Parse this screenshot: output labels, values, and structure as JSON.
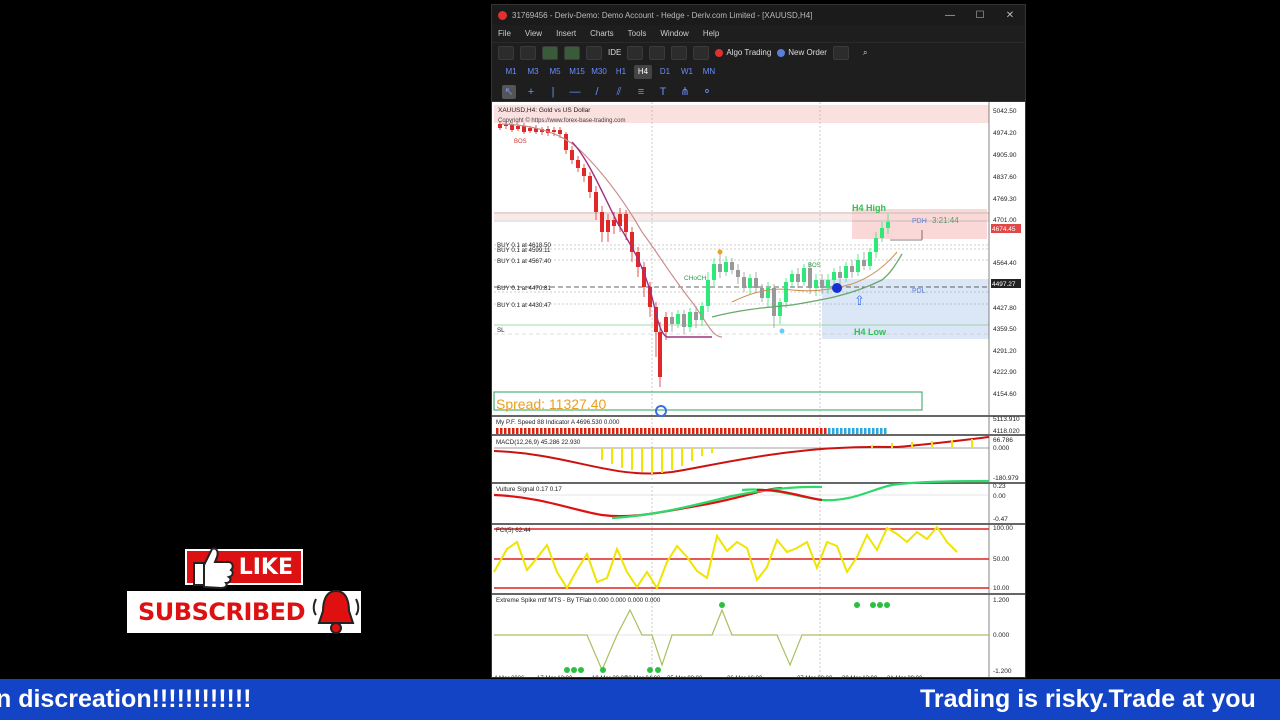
{
  "window": {
    "title": "31769456 - Deriv-Demo: Demo Account - Hedge - Deriv.com Limited - [XAUUSD,H4]",
    "controls": [
      "—",
      "☐",
      "✕"
    ]
  },
  "menu": [
    "File",
    "View",
    "Insert",
    "Charts",
    "Tools",
    "Window",
    "Help"
  ],
  "toolbar": {
    "ide": "IDE",
    "algo_trading": "Algo Trading",
    "new_order": "New Order"
  },
  "timeframes": {
    "items": [
      "M1",
      "M3",
      "M5",
      "M15",
      "M30",
      "H1",
      "H4",
      "D1",
      "W1",
      "MN"
    ],
    "active": "H4"
  },
  "chart": {
    "header": "XAUUSD,H4: Gold vs US Dollar",
    "copyright": "Copyright © https://www.forex-base-trading.com",
    "price_labels": [
      "5042.50",
      "4974.20",
      "4905.90",
      "4837.60",
      "4769.30",
      "4701.00",
      "4674.45",
      "4564.40",
      "4497.27",
      "4427.80",
      "4359.50",
      "4291.20",
      "4222.90",
      "4154.60"
    ],
    "orders": [
      "BUY 0.1 at 4618.50",
      "BUY 0.1 at 4599.11",
      "BUY 0.1 at 4567.40",
      "BUY 0.1 at 4470.81",
      "BUY 0.1 at 4430.47",
      "SL"
    ],
    "labels": {
      "h4_high": "H4 High",
      "h4_low": "H4 Low",
      "pdh": "PDH",
      "pdl": "PDL",
      "timer": "3:21:44",
      "choch": "CHoCH",
      "bos": "BOS",
      "spread": "Spread: 11327.40"
    },
    "colors": {
      "bull": "#2ee87a",
      "bear": "#e02828",
      "wick": "#999999"
    }
  },
  "subwindows": [
    {
      "title": "My P.F. Speed 88 Indicator A 4696.530 0.000",
      "scale": [
        "5113.910",
        "4118.020"
      ]
    },
    {
      "title": "MACD(12,26,9) 45.286 22.930",
      "scale": [
        "66.786",
        "0.000",
        "-180.979"
      ]
    },
    {
      "title": "Vulture Signal 0.17 0.17",
      "scale": [
        "0.23",
        "0.00",
        "-0.47"
      ]
    },
    {
      "title": "FCI(5) 62.44",
      "scale": [
        "100.00",
        "50.00",
        "10.00"
      ]
    },
    {
      "title": "Extreme Spike mtf MTS - By TFlab 0.000 0.000 0.000 0.000",
      "scale": [
        "1.200",
        "0.000",
        "-1.200"
      ]
    }
  ],
  "time_axis": [
    "4 Mar 2026",
    "17 Mar 12:00",
    "19 Mar 20:00",
    "23 Mar 04:00",
    "25 Mar 08:00",
    "26 Mar 16:00",
    "27 Mar 00:00",
    "30 Mar 12:00",
    "31 Mar 20:00"
  ],
  "overlay": {
    "like": "LIKE",
    "subscribed": "SUBSCRIBED"
  },
  "ticker": {
    "left": "n discreation!!!!!!!!!!!!",
    "right": "Trading is risky.Trade at you"
  }
}
